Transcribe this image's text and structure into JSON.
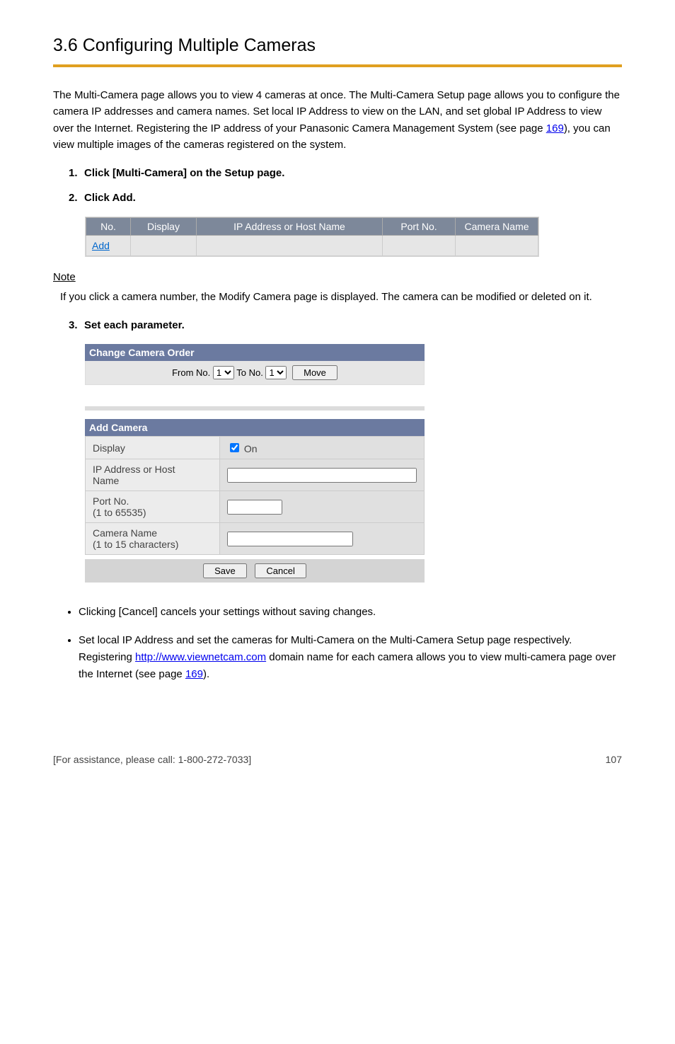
{
  "heading": "3.6 Configuring Multiple Cameras",
  "intro_before": "The Multi-Camera page allows you to view 4 cameras at once. The Multi-Camera Setup page allows you to configure the camera IP addresses and camera names. Set local IP Address to view on the LAN, and set global IP Address to view over the Internet. Registering the IP address of your Panasonic Camera Management System (see page ",
  "intro_link_text": "169",
  "intro_after": "), you can view multiple images of the cameras registered on the system.",
  "steps": {
    "s1": "Click [Multi-Camera] on the Setup page.",
    "s2": "Click Add."
  },
  "cam_table": {
    "h_no": "No.",
    "h_display": "Display",
    "h_ip": "IP Address or Host Name",
    "h_port": "Port No.",
    "h_camname": "Camera Name",
    "add_link": "Add"
  },
  "note_label": "Note",
  "note_body": "If you click a camera number, the Modify Camera page is displayed. The camera can be modified or deleted on it.",
  "step3": "Set each parameter.",
  "change_order": {
    "header": "Change Camera Order",
    "from": "From No.",
    "to": "To No.",
    "sel1": "1",
    "sel2": "1",
    "move": "Move"
  },
  "add_camera": {
    "header": "Add Camera",
    "display_label": "Display",
    "on_label": "On",
    "ip_label_l1": "IP Address or Host",
    "ip_label_l2": "Name",
    "port_label_l1": "Port No.",
    "port_label_l2": "(1 to 65535)",
    "camname_label_l1": "Camera Name",
    "camname_label_l2": "(1 to 15 characters)",
    "save": "Save",
    "cancel": "Cancel"
  },
  "trailing": {
    "bullet1": "Clicking [Cancel] cancels your settings without saving changes.",
    "bullet2_before": "Set local IP Address and set the cameras for Multi-Camera on the Multi-Camera Setup page respectively. Registering ",
    "bullet2_link": "http://www.viewnetcam.com",
    "bullet2_mid": " domain name for each camera allows you to view multi-camera page over the Internet (see page ",
    "bullet2_pagelink": "169",
    "bullet2_after": ")."
  },
  "footer_left": "[For assistance, please call: 1-800-272-7033]",
  "footer_right": "107"
}
